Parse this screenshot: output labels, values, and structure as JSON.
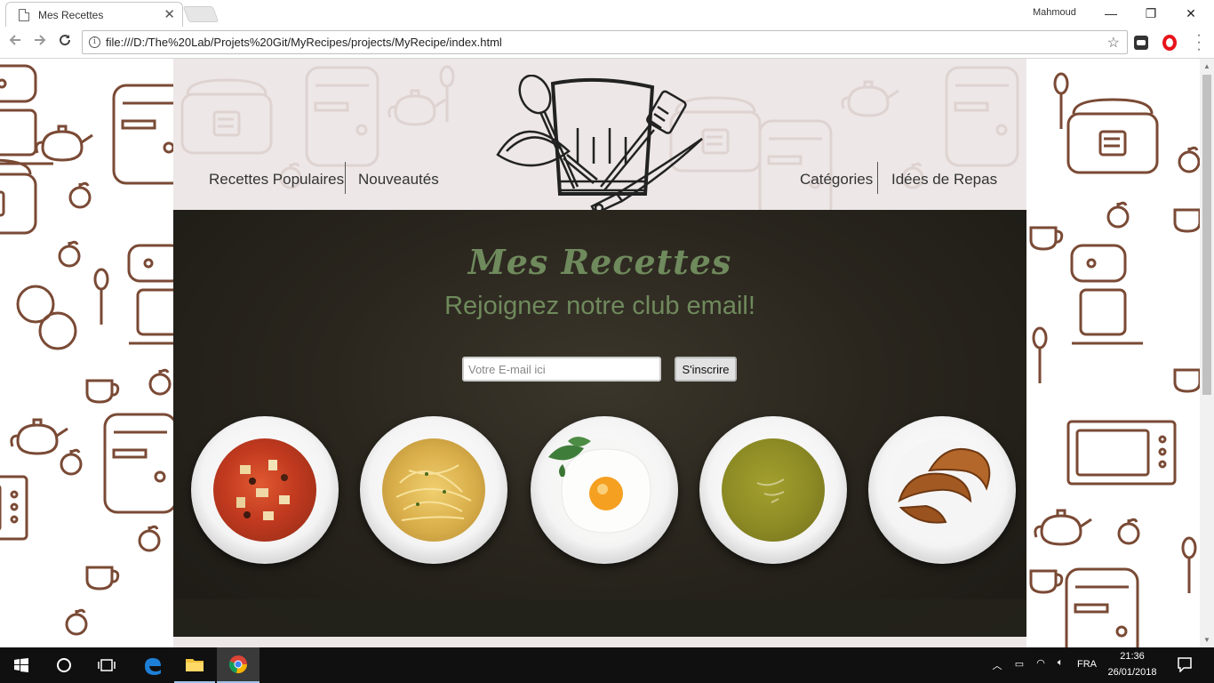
{
  "browser": {
    "tab_title": "Mes Recettes",
    "tab_close": "✕",
    "profile_name": "Mahmoud",
    "url": "file:///D:/The%20Lab/Projets%20Git/MyRecipes/projects/MyRecipe/index.html",
    "window_buttons": [
      "—",
      "❐",
      "✕"
    ]
  },
  "page": {
    "nav_left": [
      "Recettes Populaires",
      "Nouveautés"
    ],
    "nav_right": [
      "Catégories",
      "Idées de Repas"
    ],
    "hero_title": "Mes Recettes",
    "hero_subtitle": "Rejoignez notre club email!",
    "email_placeholder": "Votre E-mail ici",
    "subscribe_label": "S'inscrire",
    "plates": [
      {
        "name": "soup-tomato",
        "color": "#b8321f"
      },
      {
        "name": "spaghetti",
        "color": "#d8b35a"
      },
      {
        "name": "fried-egg",
        "color": "#f5f5f0"
      },
      {
        "name": "pea-soup",
        "color": "#8c8a24"
      },
      {
        "name": "croissants",
        "color": "#a55a24"
      }
    ],
    "accent_color": "#6f8a5c",
    "pattern_color": "#7a4a35"
  },
  "taskbar": {
    "language": "FRA",
    "time": "21:36",
    "date": "26/01/2018"
  }
}
